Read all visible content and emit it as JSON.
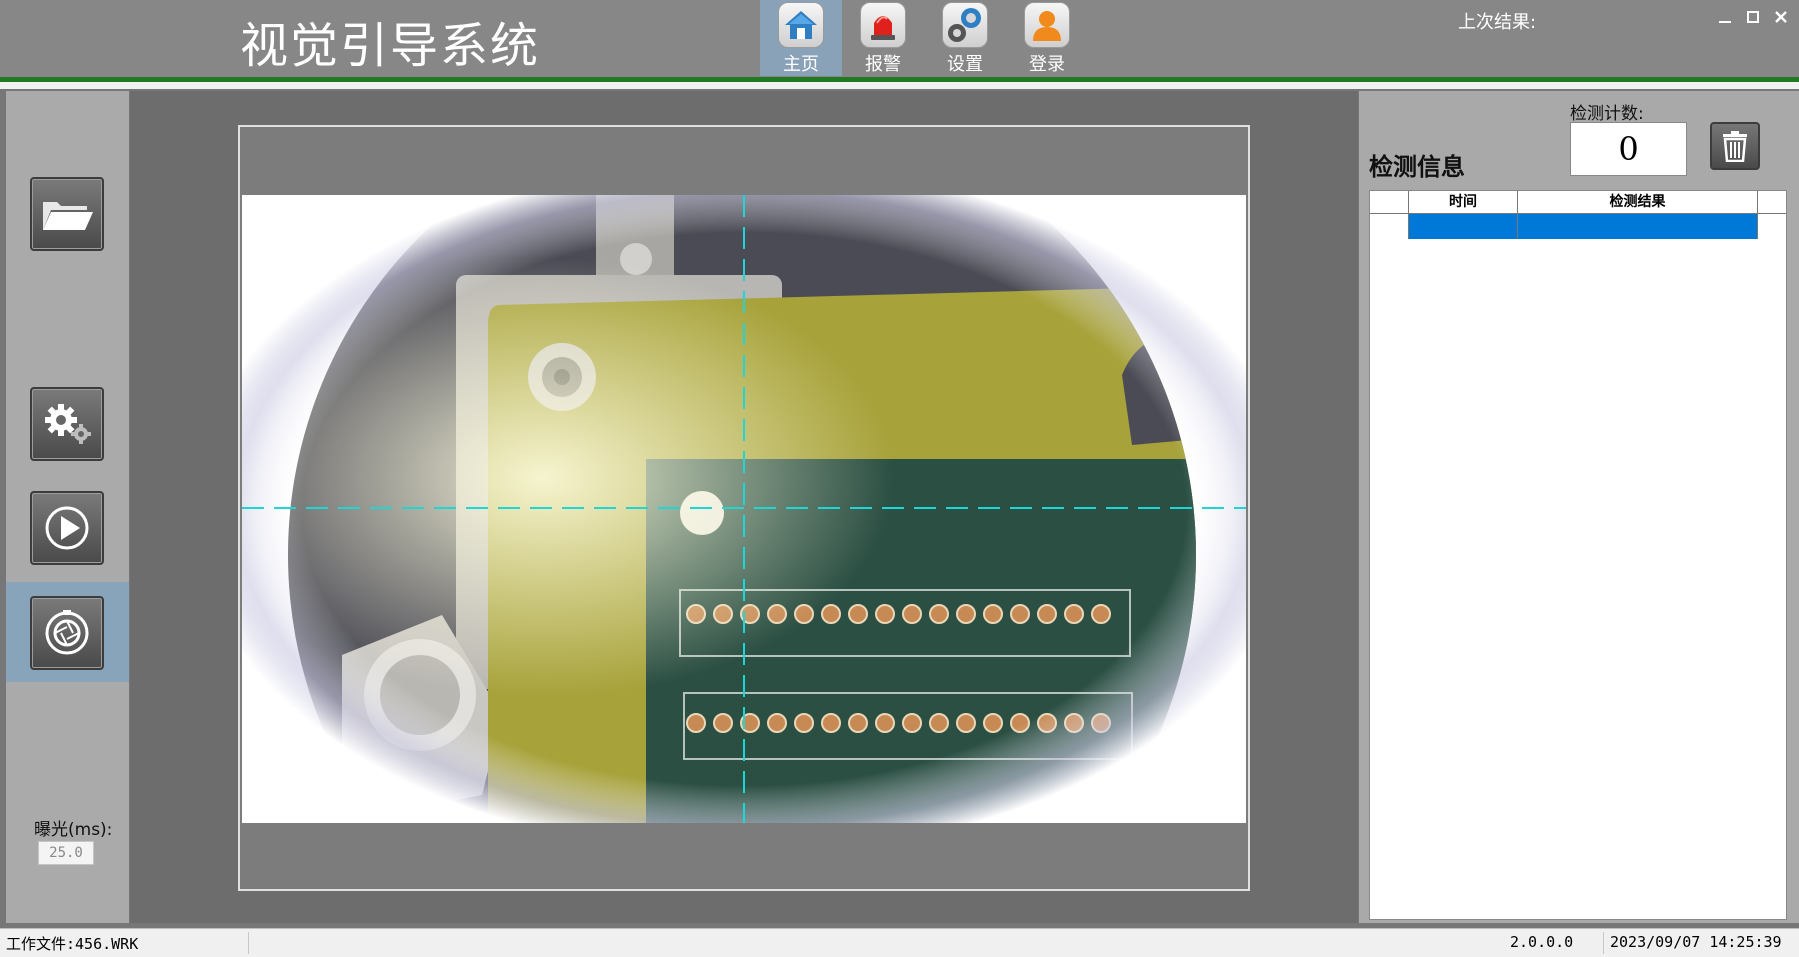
{
  "app": {
    "title": "视觉引导系统"
  },
  "nav": [
    {
      "label": "主页",
      "icon": "home-icon"
    },
    {
      "label": "报警",
      "icon": "alarm-icon"
    },
    {
      "label": "设置",
      "icon": "settings-icon"
    },
    {
      "label": "登录",
      "icon": "user-icon"
    }
  ],
  "header": {
    "last_result_label": "上次结果:",
    "last_result_value": ""
  },
  "toolbar": {
    "tools": [
      "open-folder-icon",
      "gear-icon",
      "play-icon",
      "camera-shutter-icon"
    ],
    "exposure_label": "曝光(ms):",
    "exposure_value": "25.0"
  },
  "detection": {
    "count_label": "检测计数:",
    "count_value": "0",
    "title": "检测信息",
    "columns": [
      "时间",
      "检测结果"
    ],
    "rows": [
      {
        "time": "",
        "result": ""
      }
    ]
  },
  "status": {
    "work_file": "工作文件:456.WRK",
    "version": "2.0.0.0",
    "datetime": "2023/09/07 14:25:39"
  },
  "colors": {
    "accent_green": "#1f7a22",
    "selected_blue": "#0078d7",
    "active_nav": "#8aa2b8",
    "crosshair": "#1fd6d6"
  }
}
